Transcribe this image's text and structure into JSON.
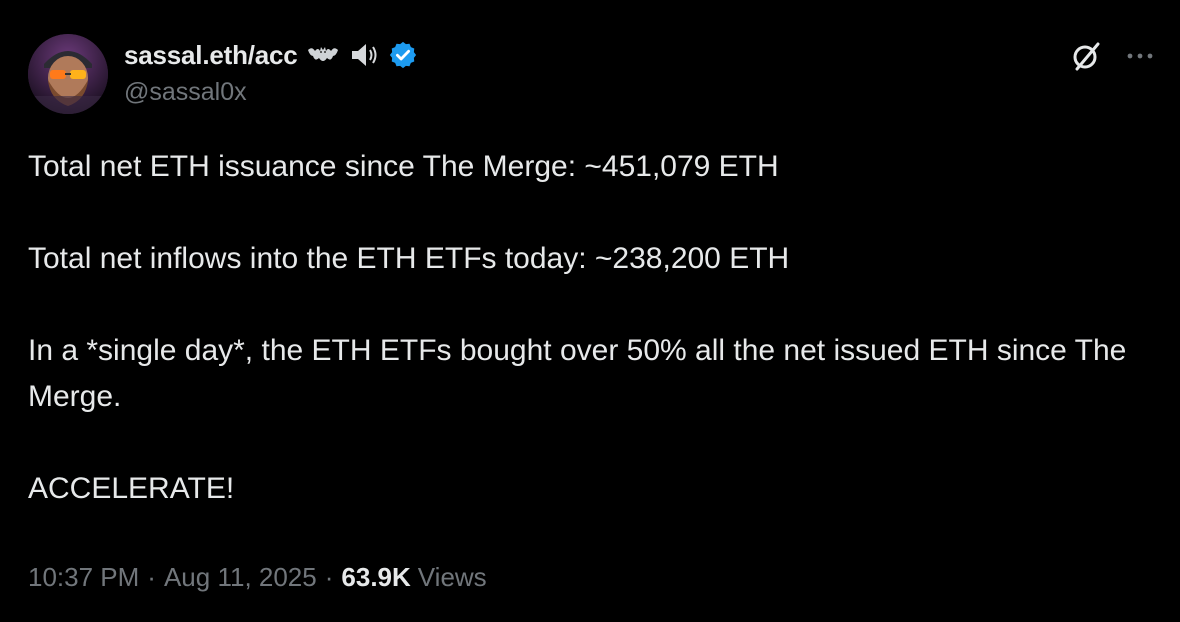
{
  "author": {
    "display_name": "sassal.eth/acc",
    "handle": "@sassal0x",
    "emoji_icons": [
      "bat-emoji",
      "speaker-emoji"
    ],
    "verified_badge": "verified-badge-icon",
    "verified_color": "#1d9bf0"
  },
  "actions": {
    "grok_icon": "grok-icon",
    "more_icon": "more-options-icon"
  },
  "tweet": {
    "paragraphs": [
      "Total net ETH issuance since The Merge: ~451,079 ETH",
      "Total net inflows into the ETH ETFs today: ~238,200 ETH",
      "In a *single day*, the ETH ETFs bought over 50% all the net issued ETH since The Merge.",
      "ACCELERATE!"
    ]
  },
  "meta": {
    "time": "10:37 PM",
    "separator": "·",
    "date": "Aug 11, 2025",
    "views_count": "63.9K",
    "views_label": "Views"
  },
  "colors": {
    "background": "#000000",
    "text_primary": "#e7e9ea",
    "text_secondary": "#71767b",
    "accent_blue": "#1d9bf0"
  }
}
